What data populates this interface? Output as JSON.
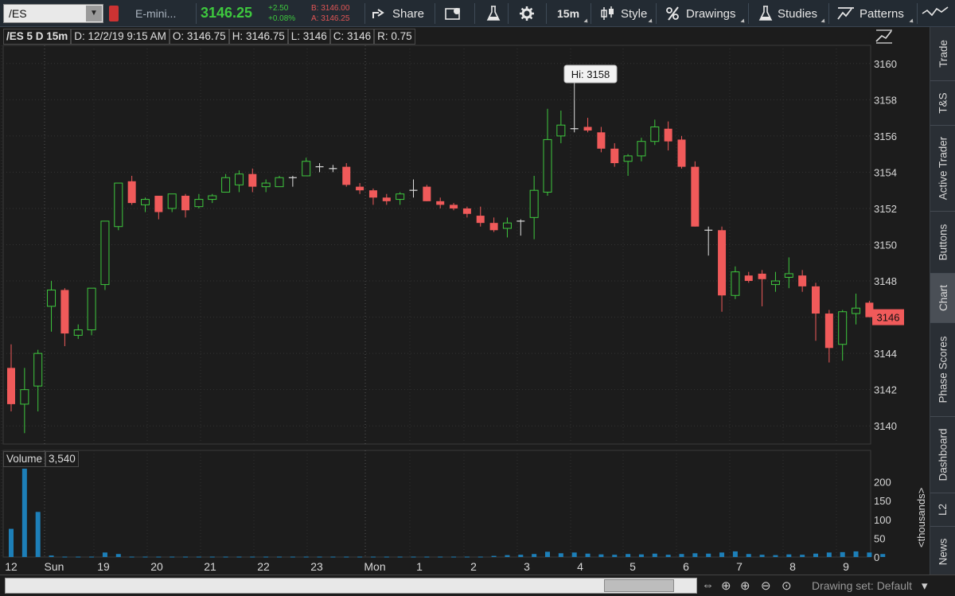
{
  "toolbar": {
    "symbol": "/ES",
    "description": "E-mini...",
    "last_price": "3146.25",
    "change": "+2.50",
    "change_pct": "+0.08%",
    "bid": "B: 3146.00",
    "ask": "A: 3146.25",
    "share_label": "Share",
    "timeframe_label": "15m",
    "style_label": "Style",
    "drawings_label": "Drawings",
    "studies_label": "Studies",
    "patterns_label": "Patterns"
  },
  "info_bar": {
    "symbol": "/ES 5 D 15m",
    "date": "D: 12/2/19 9:15 AM",
    "open": "O: 3146.75",
    "high": "H: 3146.75",
    "low": "L: 3146",
    "close": "C: 3146",
    "range": "R: 0.75"
  },
  "volume_header": {
    "label": "Volume",
    "value": "3,540"
  },
  "sidebar_tabs": [
    "Trade",
    "T&S",
    "Active Trader",
    "Buttons",
    "Chart",
    "Phase Scores",
    "Dashboard",
    "L2",
    "News"
  ],
  "active_tab": "Chart",
  "drawing_set": "Drawing set: Default",
  "colors": {
    "up": "#3ec83e",
    "down": "#f05a5a",
    "background": "#1c1c1c",
    "grid": "#3a3a3a",
    "volume": "#1d7fb8"
  },
  "chart_data": {
    "type": "candlestick",
    "title": "/ES 5 D 15m",
    "price_axis": {
      "ticks": [
        3140,
        3142,
        3144,
        3146,
        3148,
        3150,
        3152,
        3154,
        3156,
        3158,
        3160
      ],
      "range": [
        3139,
        3161
      ]
    },
    "x_axis": {
      "labels": [
        "12",
        "Sun",
        "19",
        "20",
        "21",
        "22",
        "23",
        "Mon",
        "1",
        "2",
        "3",
        "4",
        "5",
        "6",
        "7",
        "8",
        "9"
      ]
    },
    "current_price_label": "3146",
    "high_annotation": "Hi: 3158",
    "candles": [
      {
        "o": 3143.2,
        "h": 3144.5,
        "l": 3140.8,
        "c": 3141.2
      },
      {
        "o": 3141.2,
        "h": 3143.2,
        "l": 3139.6,
        "c": 3142.0
      },
      {
        "o": 3142.2,
        "h": 3144.2,
        "l": 3140.8,
        "c": 3144.0
      },
      {
        "o": 3146.6,
        "h": 3148.0,
        "l": 3145.2,
        "c": 3147.5
      },
      {
        "o": 3147.5,
        "h": 3147.6,
        "l": 3144.4,
        "c": 3145.1
      },
      {
        "o": 3145.0,
        "h": 3145.6,
        "l": 3144.8,
        "c": 3145.3
      },
      {
        "o": 3145.3,
        "h": 3147.6,
        "l": 3145.0,
        "c": 3147.6
      },
      {
        "o": 3147.8,
        "h": 3151.0,
        "l": 3147.5,
        "c": 3151.3
      },
      {
        "o": 3151.0,
        "h": 3152.8,
        "l": 3150.8,
        "c": 3153.4
      },
      {
        "o": 3153.5,
        "h": 3153.8,
        "l": 3152.2,
        "c": 3152.3
      },
      {
        "o": 3152.2,
        "h": 3152.6,
        "l": 3151.8,
        "c": 3152.5
      },
      {
        "o": 3152.7,
        "h": 3152.7,
        "l": 3151.4,
        "c": 3151.8
      },
      {
        "o": 3152.0,
        "h": 3152.8,
        "l": 3151.8,
        "c": 3152.8
      },
      {
        "o": 3152.7,
        "h": 3152.8,
        "l": 3151.5,
        "c": 3151.9
      },
      {
        "o": 3152.1,
        "h": 3152.8,
        "l": 3152.0,
        "c": 3152.5
      },
      {
        "o": 3152.5,
        "h": 3152.8,
        "l": 3152.3,
        "c": 3152.7
      },
      {
        "o": 3152.9,
        "h": 3153.9,
        "l": 3152.9,
        "c": 3153.7
      },
      {
        "o": 3153.3,
        "h": 3154.1,
        "l": 3152.9,
        "c": 3153.9
      },
      {
        "o": 3153.9,
        "h": 3154.2,
        "l": 3152.9,
        "c": 3153.2
      },
      {
        "o": 3153.2,
        "h": 3153.6,
        "l": 3152.9,
        "c": 3153.4
      },
      {
        "o": 3153.2,
        "h": 3153.8,
        "l": 3153.2,
        "c": 3153.7
      },
      {
        "o": 3153.6,
        "h": 3153.8,
        "l": 3153.2,
        "c": 3153.7
      },
      {
        "o": 3153.8,
        "h": 3154.8,
        "l": 3153.8,
        "c": 3154.6
      },
      {
        "o": 3154.3,
        "h": 3154.5,
        "l": 3154.0,
        "c": 3154.3
      },
      {
        "o": 3154.2,
        "h": 3154.4,
        "l": 3154.0,
        "c": 3154.2
      },
      {
        "o": 3154.3,
        "h": 3154.5,
        "l": 3153.2,
        "c": 3153.3
      },
      {
        "o": 3153.2,
        "h": 3153.4,
        "l": 3152.8,
        "c": 3153.0
      },
      {
        "o": 3153.0,
        "h": 3153.1,
        "l": 3152.2,
        "c": 3152.6
      },
      {
        "o": 3152.6,
        "h": 3152.8,
        "l": 3152.2,
        "c": 3152.4
      },
      {
        "o": 3152.5,
        "h": 3152.9,
        "l": 3152.2,
        "c": 3152.8
      },
      {
        "o": 3153.0,
        "h": 3153.6,
        "l": 3152.6,
        "c": 3153.0
      },
      {
        "o": 3153.2,
        "h": 3153.3,
        "l": 3152.4,
        "c": 3152.4
      },
      {
        "o": 3152.4,
        "h": 3152.6,
        "l": 3152.0,
        "c": 3152.2
      },
      {
        "o": 3152.2,
        "h": 3152.3,
        "l": 3151.9,
        "c": 3152.0
      },
      {
        "o": 3152.0,
        "h": 3152.1,
        "l": 3151.5,
        "c": 3151.7
      },
      {
        "o": 3151.6,
        "h": 3152.1,
        "l": 3151.0,
        "c": 3151.2
      },
      {
        "o": 3151.2,
        "h": 3151.5,
        "l": 3150.7,
        "c": 3150.8
      },
      {
        "o": 3150.9,
        "h": 3151.5,
        "l": 3150.4,
        "c": 3151.2
      },
      {
        "o": 3151.2,
        "h": 3151.4,
        "l": 3150.5,
        "c": 3151.3
      },
      {
        "o": 3151.5,
        "h": 3153.8,
        "l": 3150.3,
        "c": 3153.0
      },
      {
        "o": 3152.9,
        "h": 3157.5,
        "l": 3152.7,
        "c": 3155.8
      },
      {
        "o": 3156.0,
        "h": 3157.4,
        "l": 3155.6,
        "c": 3156.6
      },
      {
        "o": 3156.4,
        "h": 3158.0,
        "l": 3156.2,
        "c": 3156.4
      },
      {
        "o": 3156.5,
        "h": 3157.0,
        "l": 3156.2,
        "c": 3156.3
      },
      {
        "o": 3156.2,
        "h": 3156.5,
        "l": 3155.1,
        "c": 3155.3
      },
      {
        "o": 3155.3,
        "h": 3155.6,
        "l": 3154.3,
        "c": 3154.5
      },
      {
        "o": 3154.6,
        "h": 3155.0,
        "l": 3153.8,
        "c": 3154.9
      },
      {
        "o": 3154.9,
        "h": 3155.9,
        "l": 3154.6,
        "c": 3155.7
      },
      {
        "o": 3155.7,
        "h": 3156.9,
        "l": 3155.5,
        "c": 3156.5
      },
      {
        "o": 3156.4,
        "h": 3156.8,
        "l": 3155.2,
        "c": 3155.7
      },
      {
        "o": 3155.8,
        "h": 3156.0,
        "l": 3154.2,
        "c": 3154.3
      },
      {
        "o": 3154.3,
        "h": 3154.6,
        "l": 3151.0,
        "c": 3151.0
      },
      {
        "o": 3150.8,
        "h": 3151.0,
        "l": 3149.4,
        "c": 3150.8
      },
      {
        "o": 3150.8,
        "h": 3151.0,
        "l": 3146.3,
        "c": 3147.2
      },
      {
        "o": 3147.2,
        "h": 3148.8,
        "l": 3147.0,
        "c": 3148.5
      },
      {
        "o": 3148.3,
        "h": 3148.5,
        "l": 3147.9,
        "c": 3148.0
      },
      {
        "o": 3148.4,
        "h": 3148.6,
        "l": 3146.6,
        "c": 3148.1
      },
      {
        "o": 3147.8,
        "h": 3148.5,
        "l": 3147.4,
        "c": 3148.0
      },
      {
        "o": 3148.2,
        "h": 3149.3,
        "l": 3147.6,
        "c": 3148.4
      },
      {
        "o": 3148.3,
        "h": 3148.6,
        "l": 3147.4,
        "c": 3147.7
      },
      {
        "o": 3147.7,
        "h": 3147.9,
        "l": 3144.7,
        "c": 3146.2
      },
      {
        "o": 3146.2,
        "h": 3146.4,
        "l": 3143.5,
        "c": 3144.3
      },
      {
        "o": 3144.5,
        "h": 3146.4,
        "l": 3143.6,
        "c": 3146.3
      },
      {
        "o": 3146.2,
        "h": 3147.3,
        "l": 3145.6,
        "c": 3146.5
      },
      {
        "o": 3146.8,
        "h": 3146.9,
        "l": 3146.0,
        "c": 3146.0
      }
    ],
    "volume_axis": {
      "ticks": [
        0,
        50,
        100,
        150,
        200
      ],
      "label": "<thousands>"
    },
    "volume": [
      75,
      235,
      120,
      4,
      1,
      1,
      1,
      12,
      8,
      1,
      1,
      1,
      1,
      1,
      1,
      1,
      1,
      1,
      1,
      1,
      1,
      1,
      1,
      1,
      1,
      1,
      1,
      1,
      1,
      1,
      1,
      1,
      1,
      1,
      1,
      1,
      3,
      5,
      6,
      8,
      14,
      10,
      12,
      9,
      7,
      6,
      8,
      7,
      9,
      6,
      8,
      10,
      9,
      12,
      15,
      8,
      6,
      5,
      7,
      6,
      9,
      12,
      13,
      15,
      12,
      8
    ]
  }
}
